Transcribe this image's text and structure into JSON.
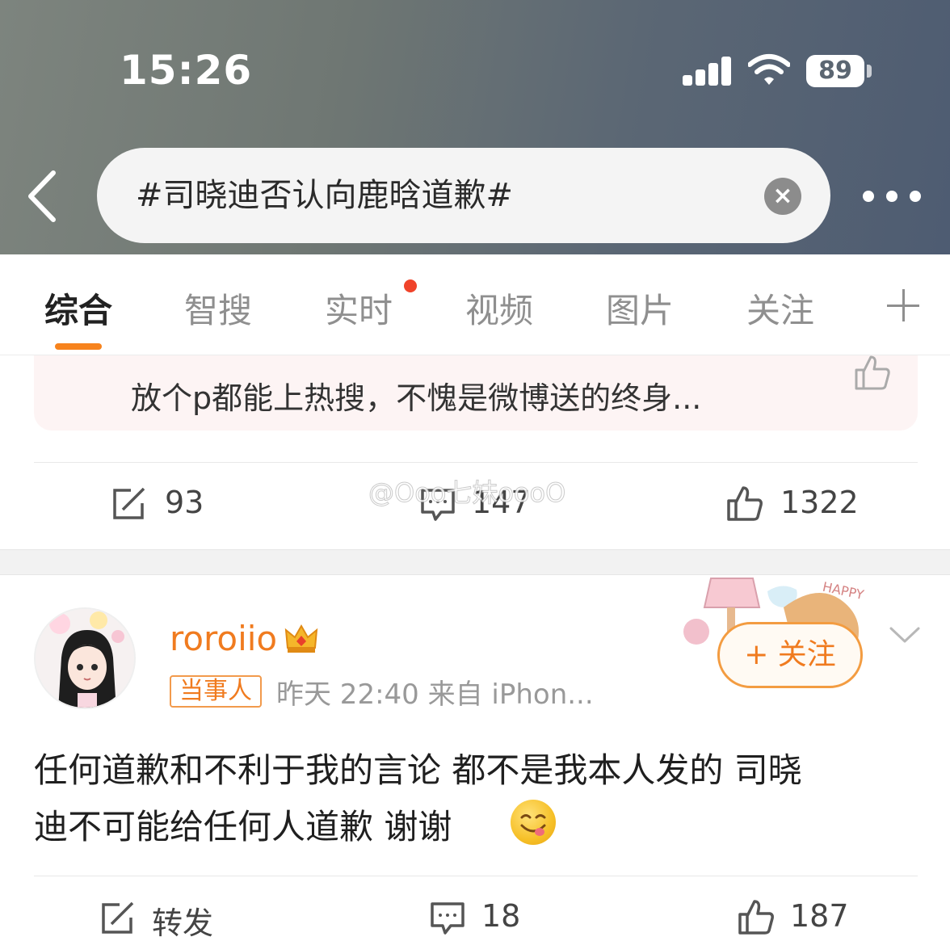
{
  "status_bar": {
    "time": "15:26",
    "battery": "89"
  },
  "search": {
    "query": "#司晓迪否认向鹿晗道歉#"
  },
  "tabs": [
    {
      "label": "综合"
    },
    {
      "label": "智搜"
    },
    {
      "label": "实时"
    },
    {
      "label": "视频"
    },
    {
      "label": "图片"
    },
    {
      "label": "关注"
    }
  ],
  "first_post": {
    "quote_text": "放个p都能上热搜，不愧是微博送的终身...",
    "repost_count": "93",
    "comment_count": "147",
    "like_count": "1322"
  },
  "watermark": "@Ooo七妹oooO",
  "second_post": {
    "username": "roroiio",
    "badge": "当事人",
    "meta": "昨天 22:40  来自 iPhon...",
    "follow_label": "+ 关注",
    "content_line1": "任何道歉和不利于我的言论 都不是我本人发的 司晓",
    "content_line2": "迪不可能给任何人道歉 谢谢",
    "repost_label": "转发",
    "comment_count": "18",
    "like_count": "187"
  },
  "colors": {
    "accent": "#f07b1f",
    "notification_dot": "#f0432a"
  }
}
